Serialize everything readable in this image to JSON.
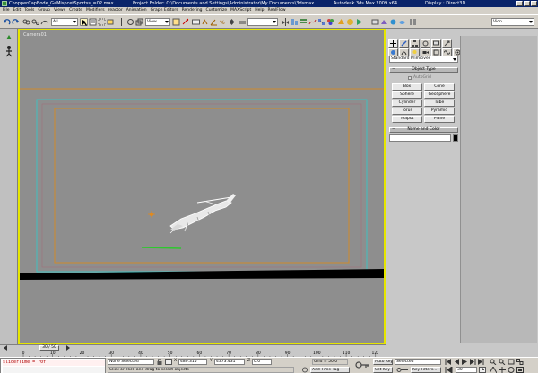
{
  "window": {
    "title": "ChopperCapBode_GaMispcetSportss_=02.max",
    "project_folder": "Project Folder: C:\\Documents and Settings\\Administrator\\My Documents\\3dsmax",
    "app_name": "Autodesk 3ds Max 2009 x64",
    "display": "Display : Direct3D"
  },
  "menu": {
    "items": [
      "File",
      "Edit",
      "Tools",
      "Group",
      "Views",
      "Create",
      "Modifiers",
      "reactor",
      "Animation",
      "Graph Editors",
      "Rendering",
      "Customize",
      "MAXScript",
      "Help",
      "RealFlow"
    ]
  },
  "toolbar": {
    "selection_filter": "All",
    "ref_coord": "View",
    "named_selection": "",
    "view_right": "Vion"
  },
  "viewport": {
    "label": "Camera01"
  },
  "command_panel": {
    "category": "Standard Primitives",
    "object_type_header": "Object Type",
    "autogrid_label": "AutoGrid",
    "buttons": [
      "Box",
      "Cone",
      "Sphere",
      "GeoSphere",
      "Cylinder",
      "Tube",
      "Torus",
      "Pyramid",
      "Teapot",
      "Plane"
    ],
    "name_color_header": "Name and Color",
    "object_name": "",
    "object_color": "#000000"
  },
  "timeline": {
    "frame_indicator": "30 / 50",
    "ticks": [
      "0",
      "10",
      "20",
      "30",
      "40",
      "50",
      "60",
      "70",
      "80",
      "90",
      "100",
      "110",
      "120"
    ]
  },
  "statusbar": {
    "listener_text": "sliderTime = 70f",
    "selection_status": "None Selected",
    "prompt": "Click or click-and-drag to select objects",
    "x_label": "X",
    "x_value": "480.315",
    "y_label": "Y",
    "y_value": "4373.431",
    "z_label": "Z",
    "z_value": "0.0",
    "grid": "Grid = 50.0",
    "add_time_tag": "Add Time Tag",
    "auto_key": "Auto Key",
    "set_key": "Set Key",
    "key_mode": "Selected",
    "key_filters": "Key Filters...",
    "current_frame": "30"
  },
  "colors": {
    "title_bar": "#0a246a",
    "viewport_bg": "#8e8e8e",
    "active_border": "#e6e600",
    "safe_frame_orange": "#d08a2a",
    "safe_frame_cyan": "#40c0c0"
  }
}
